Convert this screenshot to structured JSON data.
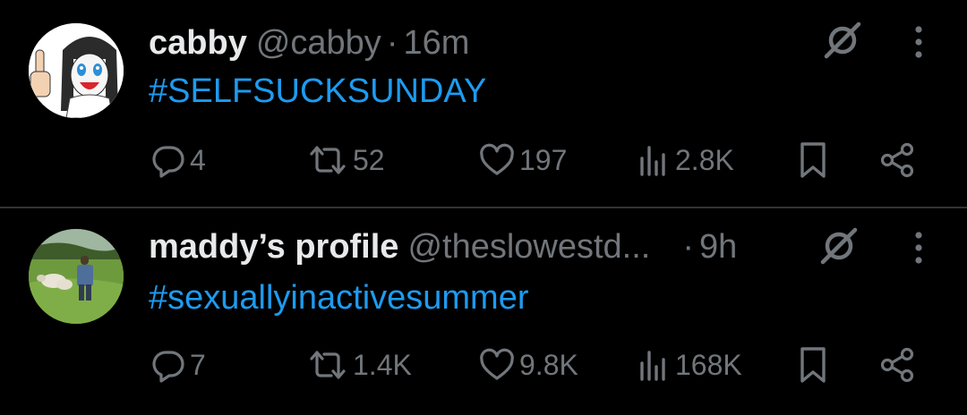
{
  "tweets": [
    {
      "display_name": "cabby",
      "handle": "@cabby",
      "separator": "·",
      "time": "16m",
      "text": "#SELFSUCKSUNDAY",
      "replies": "4",
      "retweets": "52",
      "likes": "197",
      "views": "2.8K",
      "avatar_icon": "cartoon-character-avatar"
    },
    {
      "display_name": "maddy’s profile",
      "handle": "@theslowestd...",
      "separator": "·",
      "time": "9h",
      "text": "#sexuallyinactivesummer",
      "replies": "7",
      "retweets": "1.4K",
      "likes": "9.8K",
      "views": "168K",
      "avatar_icon": "field-photo-avatar"
    }
  ],
  "colors": {
    "background": "#000000",
    "primary_text": "#e7e9ea",
    "secondary_text": "#71767b",
    "link": "#1d9bf0",
    "divider": "#2f3336"
  }
}
